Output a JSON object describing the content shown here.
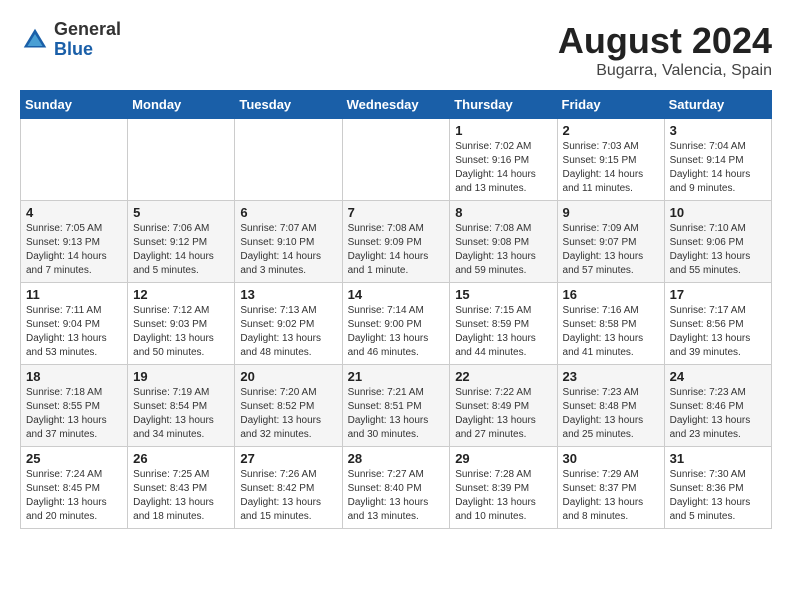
{
  "logo": {
    "general": "General",
    "blue": "Blue"
  },
  "title": "August 2024",
  "subtitle": "Bugarra, Valencia, Spain",
  "weekdays": [
    "Sunday",
    "Monday",
    "Tuesday",
    "Wednesday",
    "Thursday",
    "Friday",
    "Saturday"
  ],
  "weeks": [
    [
      {
        "day": "",
        "info": ""
      },
      {
        "day": "",
        "info": ""
      },
      {
        "day": "",
        "info": ""
      },
      {
        "day": "",
        "info": ""
      },
      {
        "day": "1",
        "info": "Sunrise: 7:02 AM\nSunset: 9:16 PM\nDaylight: 14 hours\nand 13 minutes."
      },
      {
        "day": "2",
        "info": "Sunrise: 7:03 AM\nSunset: 9:15 PM\nDaylight: 14 hours\nand 11 minutes."
      },
      {
        "day": "3",
        "info": "Sunrise: 7:04 AM\nSunset: 9:14 PM\nDaylight: 14 hours\nand 9 minutes."
      }
    ],
    [
      {
        "day": "4",
        "info": "Sunrise: 7:05 AM\nSunset: 9:13 PM\nDaylight: 14 hours\nand 7 minutes."
      },
      {
        "day": "5",
        "info": "Sunrise: 7:06 AM\nSunset: 9:12 PM\nDaylight: 14 hours\nand 5 minutes."
      },
      {
        "day": "6",
        "info": "Sunrise: 7:07 AM\nSunset: 9:10 PM\nDaylight: 14 hours\nand 3 minutes."
      },
      {
        "day": "7",
        "info": "Sunrise: 7:08 AM\nSunset: 9:09 PM\nDaylight: 14 hours\nand 1 minute."
      },
      {
        "day": "8",
        "info": "Sunrise: 7:08 AM\nSunset: 9:08 PM\nDaylight: 13 hours\nand 59 minutes."
      },
      {
        "day": "9",
        "info": "Sunrise: 7:09 AM\nSunset: 9:07 PM\nDaylight: 13 hours\nand 57 minutes."
      },
      {
        "day": "10",
        "info": "Sunrise: 7:10 AM\nSunset: 9:06 PM\nDaylight: 13 hours\nand 55 minutes."
      }
    ],
    [
      {
        "day": "11",
        "info": "Sunrise: 7:11 AM\nSunset: 9:04 PM\nDaylight: 13 hours\nand 53 minutes."
      },
      {
        "day": "12",
        "info": "Sunrise: 7:12 AM\nSunset: 9:03 PM\nDaylight: 13 hours\nand 50 minutes."
      },
      {
        "day": "13",
        "info": "Sunrise: 7:13 AM\nSunset: 9:02 PM\nDaylight: 13 hours\nand 48 minutes."
      },
      {
        "day": "14",
        "info": "Sunrise: 7:14 AM\nSunset: 9:00 PM\nDaylight: 13 hours\nand 46 minutes."
      },
      {
        "day": "15",
        "info": "Sunrise: 7:15 AM\nSunset: 8:59 PM\nDaylight: 13 hours\nand 44 minutes."
      },
      {
        "day": "16",
        "info": "Sunrise: 7:16 AM\nSunset: 8:58 PM\nDaylight: 13 hours\nand 41 minutes."
      },
      {
        "day": "17",
        "info": "Sunrise: 7:17 AM\nSunset: 8:56 PM\nDaylight: 13 hours\nand 39 minutes."
      }
    ],
    [
      {
        "day": "18",
        "info": "Sunrise: 7:18 AM\nSunset: 8:55 PM\nDaylight: 13 hours\nand 37 minutes."
      },
      {
        "day": "19",
        "info": "Sunrise: 7:19 AM\nSunset: 8:54 PM\nDaylight: 13 hours\nand 34 minutes."
      },
      {
        "day": "20",
        "info": "Sunrise: 7:20 AM\nSunset: 8:52 PM\nDaylight: 13 hours\nand 32 minutes."
      },
      {
        "day": "21",
        "info": "Sunrise: 7:21 AM\nSunset: 8:51 PM\nDaylight: 13 hours\nand 30 minutes."
      },
      {
        "day": "22",
        "info": "Sunrise: 7:22 AM\nSunset: 8:49 PM\nDaylight: 13 hours\nand 27 minutes."
      },
      {
        "day": "23",
        "info": "Sunrise: 7:23 AM\nSunset: 8:48 PM\nDaylight: 13 hours\nand 25 minutes."
      },
      {
        "day": "24",
        "info": "Sunrise: 7:23 AM\nSunset: 8:46 PM\nDaylight: 13 hours\nand 23 minutes."
      }
    ],
    [
      {
        "day": "25",
        "info": "Sunrise: 7:24 AM\nSunset: 8:45 PM\nDaylight: 13 hours\nand 20 minutes."
      },
      {
        "day": "26",
        "info": "Sunrise: 7:25 AM\nSunset: 8:43 PM\nDaylight: 13 hours\nand 18 minutes."
      },
      {
        "day": "27",
        "info": "Sunrise: 7:26 AM\nSunset: 8:42 PM\nDaylight: 13 hours\nand 15 minutes."
      },
      {
        "day": "28",
        "info": "Sunrise: 7:27 AM\nSunset: 8:40 PM\nDaylight: 13 hours\nand 13 minutes."
      },
      {
        "day": "29",
        "info": "Sunrise: 7:28 AM\nSunset: 8:39 PM\nDaylight: 13 hours\nand 10 minutes."
      },
      {
        "day": "30",
        "info": "Sunrise: 7:29 AM\nSunset: 8:37 PM\nDaylight: 13 hours\nand 8 minutes."
      },
      {
        "day": "31",
        "info": "Sunrise: 7:30 AM\nSunset: 8:36 PM\nDaylight: 13 hours\nand 5 minutes."
      }
    ]
  ]
}
